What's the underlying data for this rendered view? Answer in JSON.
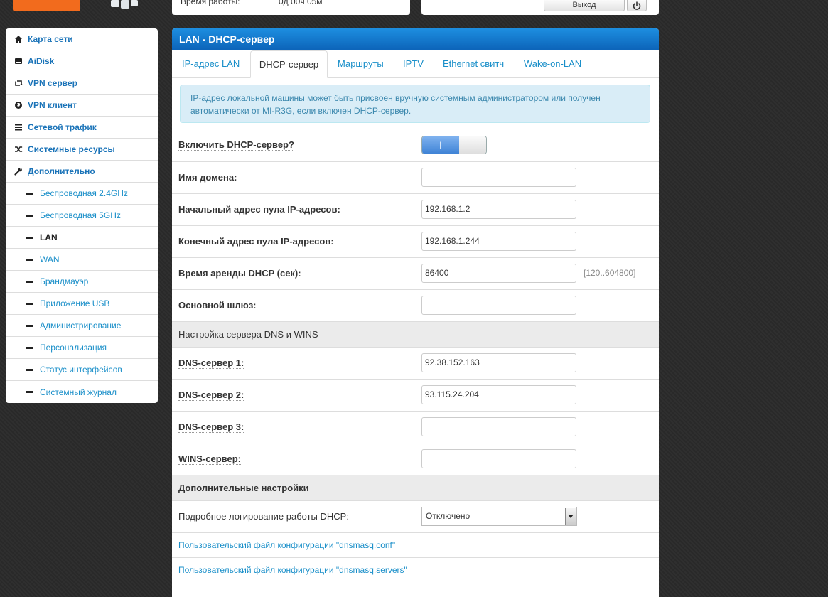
{
  "header": {
    "uptime_label": "Время работы:",
    "uptime_value": "0д 00ч 05м",
    "logout_label": "Выход"
  },
  "sidebar": {
    "items": [
      {
        "label": "Карта сети",
        "icon": "home-icon"
      },
      {
        "label": "AiDisk",
        "icon": "hdd-icon"
      },
      {
        "label": "VPN сервер",
        "icon": "retweet-icon"
      },
      {
        "label": "VPN клиент",
        "icon": "globe-icon"
      },
      {
        "label": "Сетевой трафик",
        "icon": "tasks-icon"
      },
      {
        "label": "Системные ресурсы",
        "icon": "random-icon"
      },
      {
        "label": "Дополнительно",
        "icon": "wrench-icon"
      }
    ],
    "sub_items": [
      {
        "label": "Беспроводная 2.4GHz"
      },
      {
        "label": "Беспроводная 5GHz"
      },
      {
        "label": "LAN",
        "active": true
      },
      {
        "label": "WAN"
      },
      {
        "label": "Брандмауэр"
      },
      {
        "label": "Приложение USB"
      },
      {
        "label": "Администрирование"
      },
      {
        "label": "Персонализация"
      },
      {
        "label": "Статус интерфейсов"
      },
      {
        "label": "Системный журнал"
      }
    ]
  },
  "panel": {
    "title": "LAN - DHCP-сервер",
    "tabs": [
      "IP-адрес LAN",
      "DHCP-сервер",
      "Маршруты",
      "IPTV",
      "Ethernet свитч",
      "Wake-on-LAN"
    ],
    "active_tab": "DHCP-сервер",
    "info_text": "IP-адрес локальной машины может быть присвоен вручную системным администратором или получен автоматически от MI-R3G, если включен DHCP-сервер."
  },
  "dhcp": {
    "enable_label": "Включить DHCP-сервер?",
    "enable_state": "I",
    "domain_label": "Имя домена:",
    "domain_value": "",
    "start_label": "Начальный адрес пула IP-адресов:",
    "start_value": "192.168.1.2",
    "end_label": "Конечный адрес пула IP-адресов:",
    "end_value": "192.168.1.244",
    "lease_label": "Время аренды DHCP (сек):",
    "lease_value": "86400",
    "lease_hint": "[120..604800]",
    "gateway_label": "Основной шлюз:",
    "gateway_value": ""
  },
  "dns": {
    "section_title": "Настройка сервера DNS и WINS",
    "dns1_label": "DNS-сервер 1:",
    "dns1_value": "92.38.152.163",
    "dns2_label": "DNS-сервер 2:",
    "dns2_value": "93.115.24.204",
    "dns3_label": "DNS-сервер 3:",
    "dns3_value": "",
    "wins_label": "WINS-сервер:",
    "wins_value": ""
  },
  "extra": {
    "section_title": "Дополнительные настройки",
    "log_label": "Подробное логирование работы DHCP:",
    "log_value": "Отключено",
    "link1": "Пользовательский файл конфигурации \"dnsmasq.conf\"",
    "link2": "Пользовательский файл конфигурации \"dnsmasq.servers\""
  },
  "colors": {
    "header_blue": "#0c63b8",
    "link_blue": "#1a8fc9",
    "logo_orange": "#f26b1d"
  }
}
